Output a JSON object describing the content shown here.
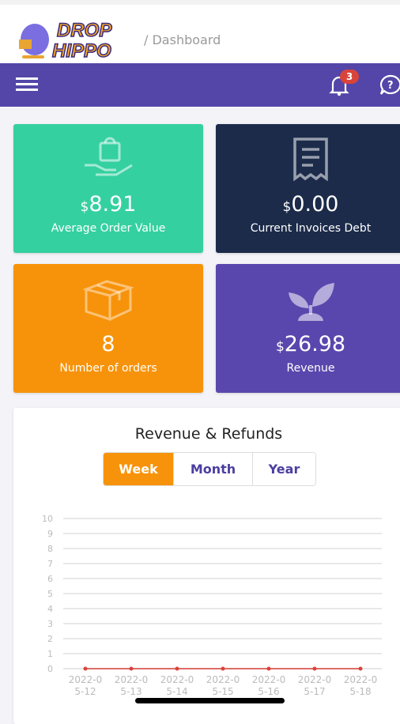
{
  "header": {
    "logo_text": "DROP HIPPO",
    "breadcrumb": "/ Dashboard",
    "notification_count": "3"
  },
  "colors": {
    "nav": "#5346a8",
    "green": "#35d0a0",
    "navy": "#1c2b4a",
    "orange": "#f7930a",
    "purple": "#5a47ad",
    "line": "#d9443a"
  },
  "cards": [
    {
      "currency": "$",
      "value": "8.91",
      "label": "Average Order Value",
      "icon": "shopping-bag-hand-icon"
    },
    {
      "currency": "$",
      "value": "0.00",
      "label": "Current Invoices Debt",
      "icon": "receipt-icon"
    },
    {
      "currency": "",
      "value": "8",
      "label": "Number of orders",
      "icon": "box-icon"
    },
    {
      "currency": "$",
      "value": "26.98",
      "label": "Revenue",
      "icon": "plant-icon"
    }
  ],
  "chart": {
    "title": "Revenue & Refunds",
    "tabs": [
      "Week",
      "Month",
      "Year"
    ],
    "active_tab": "Week"
  },
  "chart_data": {
    "type": "line",
    "title": "Revenue & Refunds",
    "x": [
      "2022-05-12",
      "2022-05-13",
      "2022-05-14",
      "2022-05-15",
      "2022-05-16",
      "2022-05-17",
      "2022-05-18"
    ],
    "x_tick_labels": [
      [
        "2022-0",
        "5-12"
      ],
      [
        "2022-0",
        "5-13"
      ],
      [
        "2022-0",
        "5-14"
      ],
      [
        "2022-0",
        "5-15"
      ],
      [
        "2022-0",
        "5-16"
      ],
      [
        "2022-0",
        "5-17"
      ],
      [
        "2022-0",
        "5-18"
      ]
    ],
    "series": [
      {
        "values": [
          0,
          0,
          0,
          0,
          0,
          0,
          0
        ],
        "color": "#d9443a"
      }
    ],
    "ylim": [
      0,
      10
    ],
    "yticks": [
      0,
      1,
      2,
      3,
      4,
      5,
      6,
      7,
      8,
      9,
      10
    ],
    "grid": true
  }
}
